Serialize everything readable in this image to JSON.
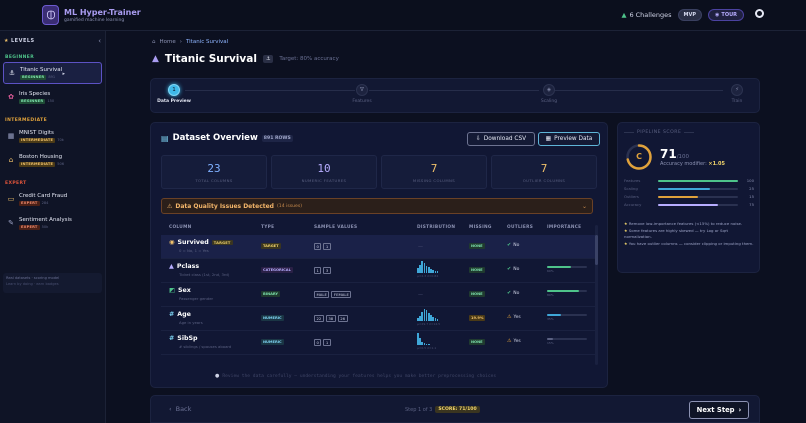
{
  "app": {
    "title": "ML Hyper-Trainer",
    "subtitle": "gamified machine learning",
    "challenges": "6 Challenges",
    "mvp": "MVP",
    "tour": "TOUR"
  },
  "sidebar": {
    "header": "LEVELS",
    "groups": {
      "beginner": "BEGINNER",
      "intermediate": "INTERMEDIATE",
      "expert": "EXPERT"
    },
    "items": [
      {
        "name": "Titanic Survival",
        "tag": "BEGINNER",
        "score": "891"
      },
      {
        "name": "Iris Species",
        "tag": "BEGINNER",
        "score": "150"
      },
      {
        "name": "MNIST Digits",
        "tag": "INTERMEDIATE",
        "score": "70k"
      },
      {
        "name": "Boston Housing",
        "tag": "INTERMEDIATE",
        "score": "506"
      },
      {
        "name": "Credit Card Fraud",
        "tag": "EXPERT",
        "score": "284"
      },
      {
        "name": "Sentiment Analysis",
        "tag": "EXPERT",
        "score": "50k"
      }
    ],
    "note_line1": "Real datasets · scoring model",
    "note_line2": "Learn by doing · earn badges"
  },
  "breadcrumb": {
    "home": "Home",
    "current": "Titanic Survival"
  },
  "page": {
    "title": "Titanic Survival",
    "target": "Target: 80% accuracy"
  },
  "stepper": {
    "steps": [
      {
        "label": "Data Preview",
        "icon": "1"
      },
      {
        "label": "Features",
        "icon": "∇"
      },
      {
        "label": "Scaling",
        "icon": "◈"
      },
      {
        "label": "Train",
        "icon": "⚡"
      }
    ]
  },
  "dataset": {
    "title": "Dataset Overview",
    "rows_badge": "891 ROWS",
    "download_label": "Download CSV",
    "preview_label": "Preview Data",
    "stats": [
      {
        "value": "23",
        "caption": "TOTAL COLUMNS",
        "color": "#7fb0ff"
      },
      {
        "value": "10",
        "caption": "NUMERIC FEATURES",
        "color": "#b7adff"
      },
      {
        "value": "7",
        "caption": "MISSING COLUMNS",
        "color": "#f1c26b"
      },
      {
        "value": "7",
        "caption": "OUTLIER COLUMNS",
        "color": "#f1c26b"
      }
    ],
    "dq_title": "Data Quality Issues Detected",
    "dq_count": "(14 issues)",
    "columns_header": {
      "column": "COLUMN",
      "type": "TYPE",
      "samples": "SAMPLE VALUES",
      "distribution": "DISTRIBUTION",
      "missing": "MISSING",
      "outliers": "OUTLIERS",
      "importance": "IMPORTANCE"
    },
    "rows": [
      {
        "name": "Survived",
        "target": "TARGET",
        "sub": "0 = No, 1 = Yes",
        "type": "TARGET",
        "samples": [
          "0",
          "1"
        ],
        "missing": "NONE",
        "outliers": "No",
        "importance": 0,
        "imp_label": ""
      },
      {
        "name": "Pclass",
        "sub": "Ticket class (1st, 2nd, 3rd)",
        "type": "CATEGORICAL",
        "samples": [
          "1",
          "3"
        ],
        "missing": "NONE",
        "outliers": "No",
        "importance": 0.6,
        "imp_label": "60%",
        "dist_label": "μ=2.3 σ=0.84"
      },
      {
        "name": "Sex",
        "sub": "Passenger gender",
        "type": "BINARY",
        "samples": [
          "MALE",
          "FEMALE"
        ],
        "missing": "NONE",
        "outliers": "No",
        "importance": 0.8,
        "imp_label": "80%"
      },
      {
        "name": "Age",
        "sub": "Age in years",
        "type": "NUMERIC",
        "samples": [
          "22",
          "38",
          "26"
        ],
        "missing": "19.9%",
        "outliers": "Yes",
        "importance": 0.35,
        "imp_label": "35%",
        "dist_label": "μ=29.7 σ=14.5"
      },
      {
        "name": "SibSp",
        "sub": "# siblings / spouses aboard",
        "type": "NUMERIC",
        "samples": [
          "0",
          "1"
        ],
        "missing": "NONE",
        "outliers": "Yes",
        "importance": 0.15,
        "imp_label": "15%",
        "dist_label": "μ=0.5 σ=1.1"
      }
    ],
    "tip": "Review the data carefully — understanding your features helps you make better preprocessing choices"
  },
  "pipeline": {
    "header": "PIPELINE SCORE",
    "grade": "C",
    "score": "71",
    "score_max": "/100",
    "modifier_label": "Accuracy modifier:",
    "modifier_value": "×1.05",
    "score_fraction": 0.71,
    "bars": [
      {
        "label": "Features",
        "value": "100",
        "fraction": 1.0,
        "color": "#4ec38a"
      },
      {
        "label": "Scaling",
        "value": "25",
        "fraction": 0.65,
        "color": "#3fa7d8"
      },
      {
        "label": "Outliers",
        "value": "15",
        "fraction": 0.5,
        "color": "#e0a23b"
      },
      {
        "label": "Accuracy",
        "value": "75",
        "fraction": 0.75,
        "color": "#b7adff"
      }
    ],
    "recs": [
      "Remove low-importance features (<15%) to reduce noise.",
      "Some features are highly skewed — try Log or Sqrt normalization.",
      "You have outlier columns — consider clipping or imputing them."
    ]
  },
  "footer": {
    "back": "Back",
    "step_of": "Step 1 of 3",
    "score_chip": "SCORE: 71/100",
    "next": "Next Step"
  }
}
